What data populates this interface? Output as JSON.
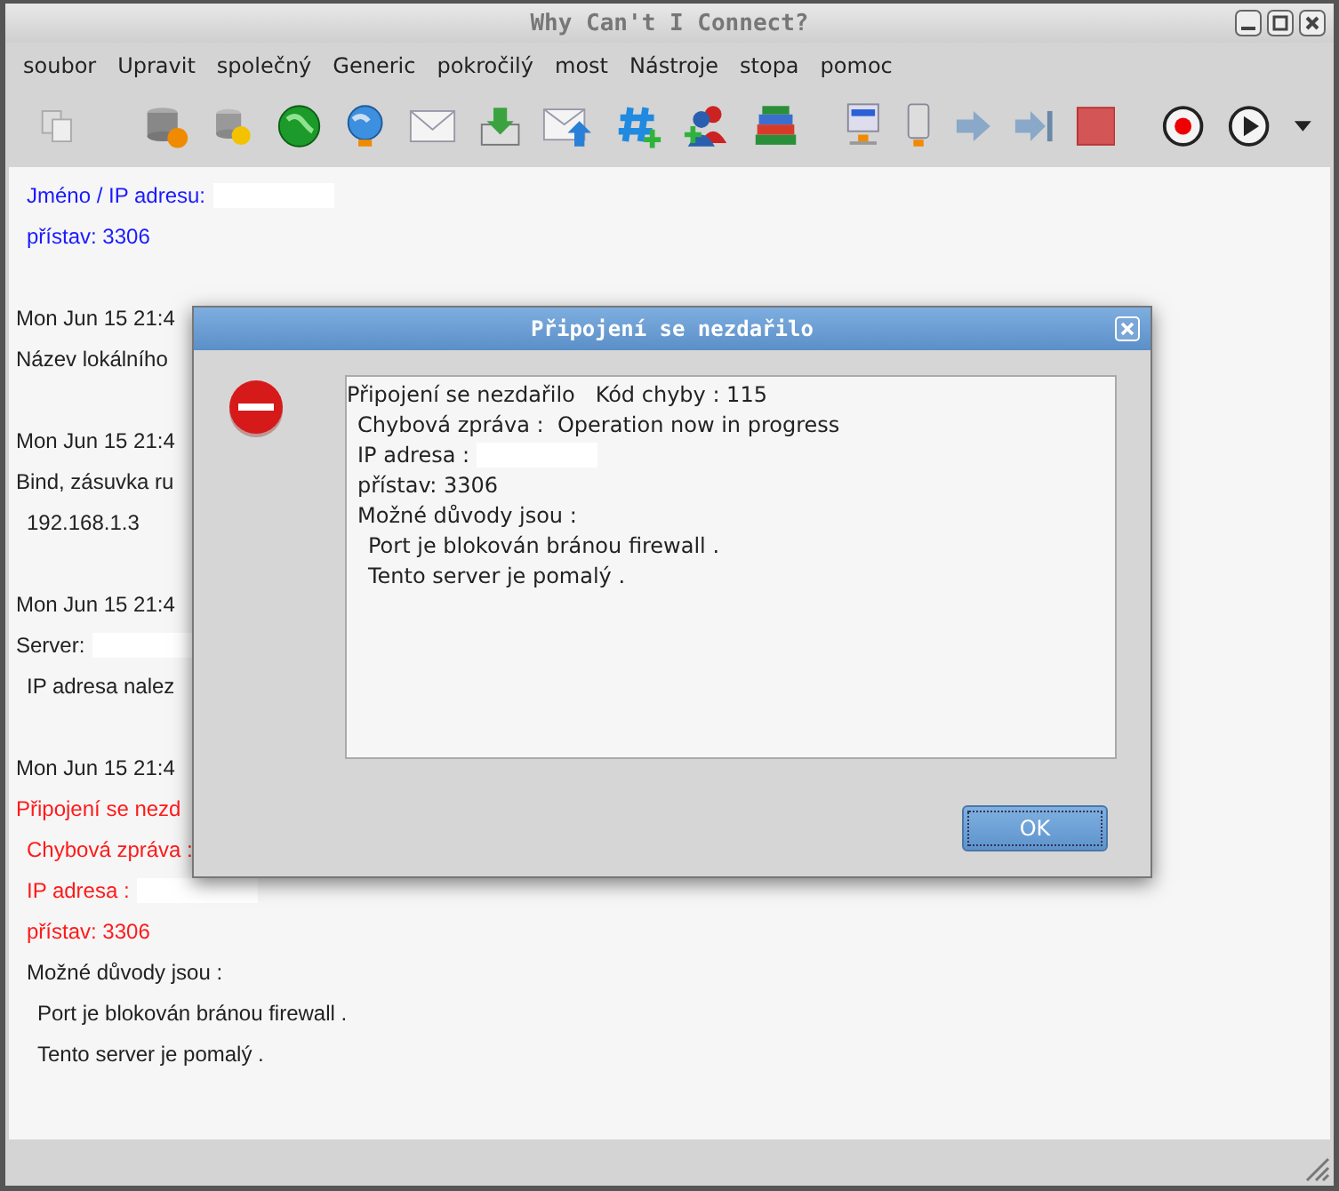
{
  "window": {
    "title": "Why Can't I Connect?"
  },
  "menu": [
    "soubor",
    "Upravit",
    "společný",
    "Generic",
    "pokročilý",
    "most",
    "Nástroje",
    "stopa",
    "pomoc"
  ],
  "log": [
    {
      "text": "Jméno / IP adresu:",
      "kind": "sub",
      "color": "#1a1aff",
      "redacted": true
    },
    {
      "text": "přístav: 3306",
      "kind": "sub",
      "color": "#1a1aff",
      "redacted": false
    },
    {
      "text": "Mon Jun 15 21:4",
      "kind": "head",
      "color": "#222222",
      "redacted": false
    },
    {
      "text": "Název lokálního",
      "kind": "line",
      "color": "#222222",
      "redacted": false
    },
    {
      "text": "Mon Jun 15 21:4",
      "kind": "head",
      "color": "#222222",
      "redacted": false
    },
    {
      "text": "Bind, zásuvka ru",
      "kind": "line",
      "color": "#222222",
      "redacted": false
    },
    {
      "text": "192.168.1.3",
      "kind": "sub",
      "color": "#222222",
      "redacted": false
    },
    {
      "text": "Mon Jun 15 21:4",
      "kind": "head",
      "color": "#222222",
      "redacted": false
    },
    {
      "text": "Server:",
      "kind": "line",
      "color": "#222222",
      "redacted": true
    },
    {
      "text": "IP adresa nalez",
      "kind": "sub",
      "color": "#222222",
      "redacted": false
    },
    {
      "text": "Mon Jun 15 21:4",
      "kind": "head",
      "color": "#222222",
      "redacted": false
    },
    {
      "text": "Připojení se nezd",
      "kind": "line",
      "color": "#ff1a1a",
      "redacted": false
    },
    {
      "text": "Chybová zpráva :",
      "kind": "sub",
      "color": "#ff1a1a",
      "redacted": false
    },
    {
      "text": "IP adresa :",
      "kind": "sub",
      "color": "#ff1a1a",
      "redacted": true
    },
    {
      "text": "přístav: 3306",
      "kind": "sub",
      "color": "#ff1a1a",
      "redacted": false
    },
    {
      "text": "Možné důvody jsou :",
      "kind": "sub",
      "color": "#222222",
      "redacted": false
    },
    {
      "text": "Port je blokován bránou firewall .",
      "kind": "subsub",
      "color": "#222222",
      "redacted": false
    },
    {
      "text": "Tento server je pomalý .",
      "kind": "subsub",
      "color": "#222222",
      "redacted": false
    }
  ],
  "dialog": {
    "title": "Připojení se nezdařilo",
    "lines": [
      {
        "text": "Připojení se nezdařilo   Kód chyby : 115",
        "kind": "line",
        "redacted": false
      },
      {
        "text": "Chybová zpráva :  Operation now in progress",
        "kind": "sub",
        "redacted": false
      },
      {
        "text": "IP adresa :",
        "kind": "sub",
        "redacted": true
      },
      {
        "text": "přístav: 3306",
        "kind": "sub",
        "redacted": false
      },
      {
        "text": "Možné důvody jsou :",
        "kind": "sub",
        "redacted": false
      },
      {
        "text": "Port je blokován bránou firewall .",
        "kind": "subsub",
        "redacted": false
      },
      {
        "text": "Tento server je pomalý .",
        "kind": "subsub",
        "redacted": false
      }
    ],
    "button": "OK"
  }
}
